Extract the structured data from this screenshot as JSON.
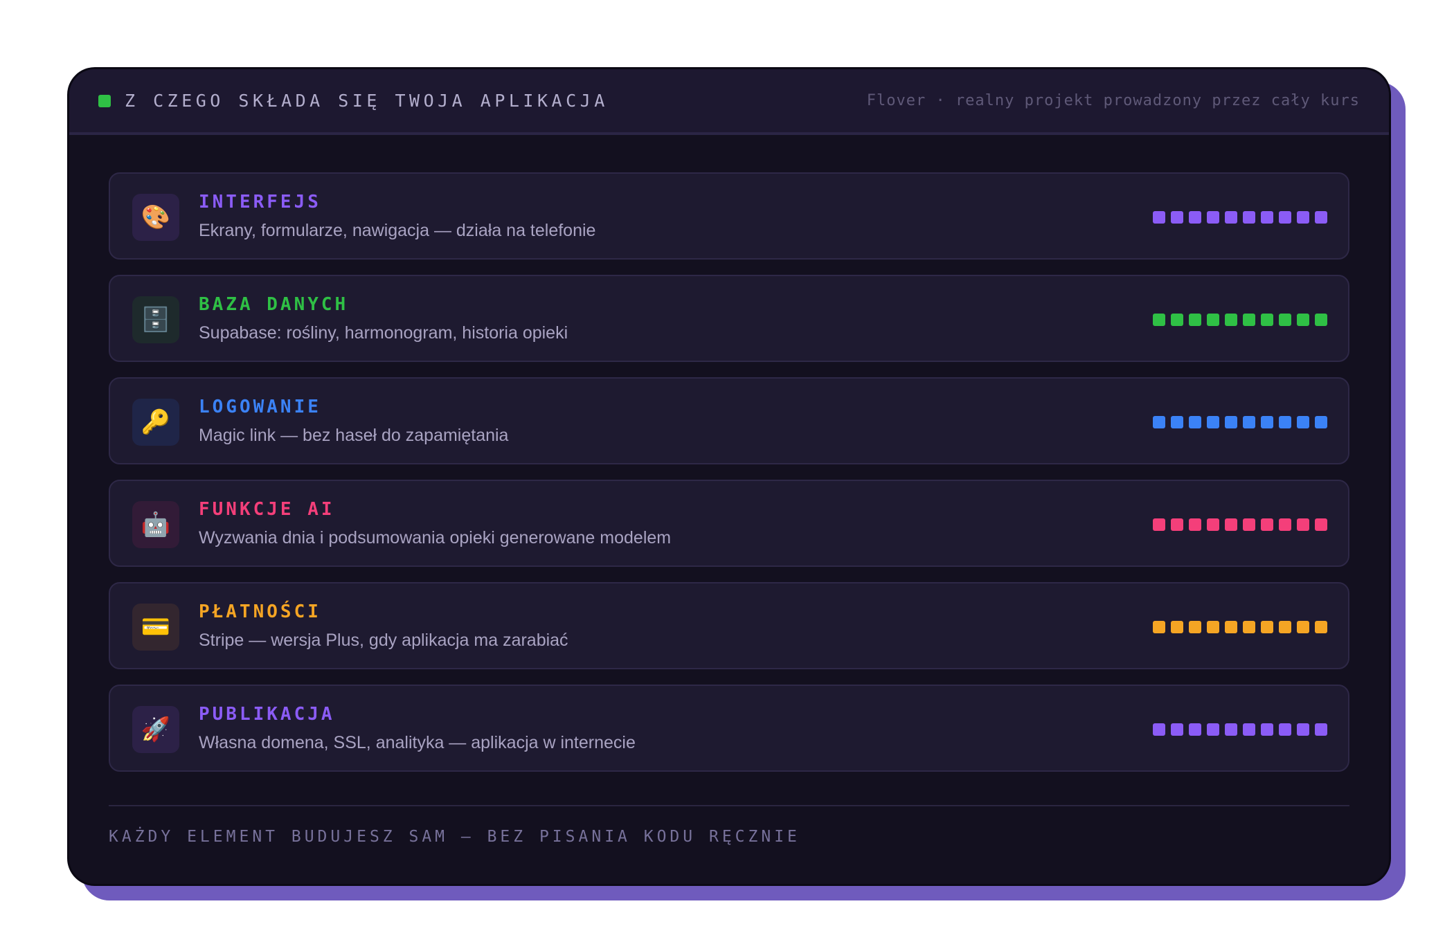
{
  "header": {
    "title": "Z CZEGO SKŁADA SIĘ TWOJA APLIKACJA",
    "subtitle": "Flover · realny projekt prowadzony przez cały kurs",
    "status_color": "#2fc045"
  },
  "modules": [
    {
      "title": "INTERFEJS",
      "description": "Ekrany, formularze, nawigacja — działa na telefonie",
      "icon": "🎨",
      "icon_name": "palette-icon",
      "color": "#8b5cf6",
      "icon_bg": "#2c2147",
      "progress": 10,
      "progress_max": 10
    },
    {
      "title": "BAZA DANYCH",
      "description": "Supabase: rośliny, harmonogram, historia opieki",
      "icon": "🗄️",
      "icon_name": "file-cabinet-icon",
      "color": "#2fc045",
      "icon_bg": "#1e2a2c",
      "progress": 10,
      "progress_max": 10
    },
    {
      "title": "LOGOWANIE",
      "description": "Magic link — bez haseł do zapamiętania",
      "icon": "🔑",
      "icon_name": "key-icon",
      "color": "#3b82f6",
      "icon_bg": "#1f2548",
      "progress": 10,
      "progress_max": 10
    },
    {
      "title": "FUNKCJE AI",
      "description": "Wyzwania dnia i podsumowania opieki generowane modelem",
      "icon": "🤖",
      "icon_name": "robot-icon",
      "color": "#f43f7a",
      "icon_bg": "#321b37",
      "progress": 10,
      "progress_max": 10
    },
    {
      "title": "PŁATNOŚCI",
      "description": "Stripe — wersja Plus, gdy aplikacja ma zarabiać",
      "icon": "💳",
      "icon_name": "credit-card-icon",
      "color": "#f5a524",
      "icon_bg": "#33262f",
      "progress": 10,
      "progress_max": 10
    },
    {
      "title": "PUBLIKACJA",
      "description": "Własna domena, SSL, analityka — aplikacja w internecie",
      "icon": "🚀",
      "icon_name": "rocket-icon",
      "color": "#8b5cf6",
      "icon_bg": "#2c2147",
      "progress": 10,
      "progress_max": 10
    }
  ],
  "footer": {
    "text": "KAŻDY ELEMENT BUDUJESZ SAM — BEZ PISANIA KODU RĘCZNIE"
  }
}
